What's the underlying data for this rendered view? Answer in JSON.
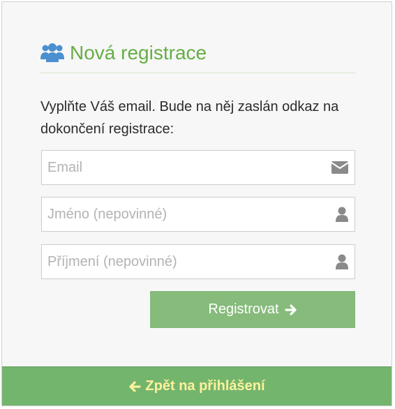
{
  "header": {
    "icon": "users-icon",
    "title": "Nová registrace"
  },
  "intro": {
    "text": "Vyplňte Váš email. Bude na něj zaslán odkaz na dokončení registrace:"
  },
  "form": {
    "email": {
      "placeholder": "Email",
      "value": "",
      "icon": "envelope-icon"
    },
    "first_name": {
      "placeholder": "Jméno (nepovinné)",
      "value": "",
      "icon": "user-icon"
    },
    "last_name": {
      "placeholder": "Příjmení (nepovinné)",
      "value": "",
      "icon": "user-icon"
    },
    "submit_label": "Registrovat",
    "submit_icon": "arrow-right-icon"
  },
  "footer": {
    "back_label": "Zpět na přihlášení",
    "back_icon": "arrow-left-icon"
  },
  "colors": {
    "title_green": "#67ad45",
    "button_green": "#86bb7b",
    "footer_green": "#74b56e",
    "footer_text": "#fdf29a",
    "icon_blue": "#4a90d0",
    "icon_gray": "#8a8a8a"
  }
}
